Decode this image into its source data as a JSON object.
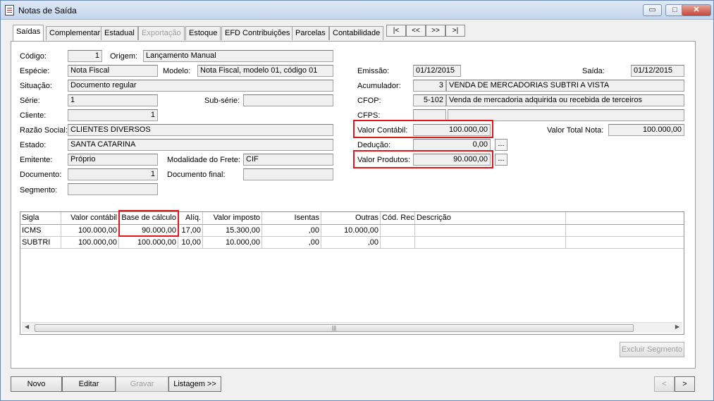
{
  "window": {
    "title": "Notas de Saída",
    "minimize": "▭",
    "maximize": "□",
    "close": "✕"
  },
  "tabs": [
    "Saídas",
    "Complementar",
    "Estadual",
    "Exportação",
    "Estoque",
    "EFD Contribuições",
    "Parcelas",
    "Contabilidade"
  ],
  "nav": {
    "first": "|<",
    "prev": "<<",
    "next": ">>",
    "last": ">|"
  },
  "form": {
    "codigo_label": "Código:",
    "codigo": "1",
    "origem_label": "Origem:",
    "origem": "Lançamento Manual",
    "especie_label": "Espécie:",
    "especie": "Nota Fiscal",
    "modelo_label": "Modelo:",
    "modelo": "Nota Fiscal, modelo 01, código 01",
    "situacao_label": "Situação:",
    "situacao": "Documento regular",
    "serie_label": "Série:",
    "serie": "1",
    "subserie_label": "Sub-série:",
    "subserie": "",
    "cliente_label": "Cliente:",
    "cliente": "1",
    "razao_label": "Razão Social:",
    "razao": "CLIENTES DIVERSOS",
    "estado_label": "Estado:",
    "estado": "SANTA CATARINA",
    "emitente_label": "Emitente:",
    "emitente": "Próprio",
    "frete_label": "Modalidade do Frete:",
    "frete": "CIF",
    "documento_label": "Documento:",
    "documento": "1",
    "docfinal_label": "Documento final:",
    "docfinal": "",
    "segmento_label": "Segmento:",
    "segmento": "",
    "emissao_label": "Emissão:",
    "emissao": "01/12/2015",
    "saida_label": "Saída:",
    "saida": "01/12/2015",
    "acumulador_label": "Acumulador:",
    "acumulador_cod": "3",
    "acumulador_desc": "VENDA DE MERCADORIAS SUBTRI  A VISTA",
    "cfop_label": "CFOP:",
    "cfop_cod": "5-102",
    "cfop_desc": "Venda de mercadoria adquirida ou recebida de terceiros",
    "cfps_label": "CFPS:",
    "cfps_cod": "",
    "cfps_desc": "",
    "valor_contabil_label": "Valor Contábil:",
    "valor_contabil": "100.000,00",
    "valor_total_label": "Valor Total Nota:",
    "valor_total": "100.000,00",
    "deducao_label": "Dedução:",
    "deducao": "0,00",
    "valor_produtos_label": "Valor Produtos:",
    "valor_produtos": "90.000,00",
    "ellipsis": "..."
  },
  "grid": {
    "headers": [
      "Sigla",
      "Valor contábil",
      "Base de cálculo",
      "Alíq.",
      "Valor imposto",
      "Isentas",
      "Outras",
      "Cód. Rec.",
      "Descrição"
    ],
    "rows": [
      [
        "ICMS",
        "100.000,00",
        "90.000,00",
        "17,00",
        "15.300,00",
        ",00",
        "10.000,00",
        "",
        ""
      ],
      [
        "SUBTRI",
        "100.000,00",
        "100.000,00",
        "10,00",
        "10.000,00",
        ",00",
        ",00",
        "",
        ""
      ]
    ],
    "scroll_grip": "|||"
  },
  "buttons": {
    "excluir_segmento": "Excluir Segmento",
    "novo": "Novo",
    "editar": "Editar",
    "gravar": "Gravar",
    "listagem": "Listagem >>",
    "prev": "<",
    "next": ">"
  }
}
